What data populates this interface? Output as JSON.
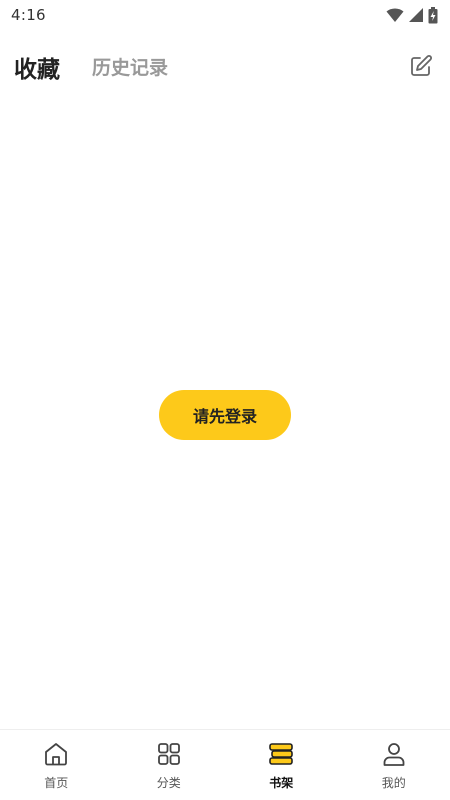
{
  "status_bar": {
    "time": "4:16",
    "icons": [
      "wifi-icon",
      "signal-icon",
      "battery-charging-icon"
    ]
  },
  "header": {
    "tabs": [
      {
        "label": "收藏",
        "active": true
      },
      {
        "label": "历史记录",
        "active": false
      }
    ],
    "edit_icon": "edit-icon"
  },
  "main": {
    "login_button_label": "请先登录"
  },
  "bottom_nav": {
    "items": [
      {
        "label": "首页",
        "icon": "home-icon",
        "active": false
      },
      {
        "label": "分类",
        "icon": "grid-icon",
        "active": false
      },
      {
        "label": "书架",
        "icon": "bookshelf-icon",
        "active": true
      },
      {
        "label": "我的",
        "icon": "user-icon",
        "active": false
      }
    ]
  },
  "colors": {
    "accent": "#fdc91a",
    "text_primary": "#222222",
    "text_secondary": "#999999"
  }
}
